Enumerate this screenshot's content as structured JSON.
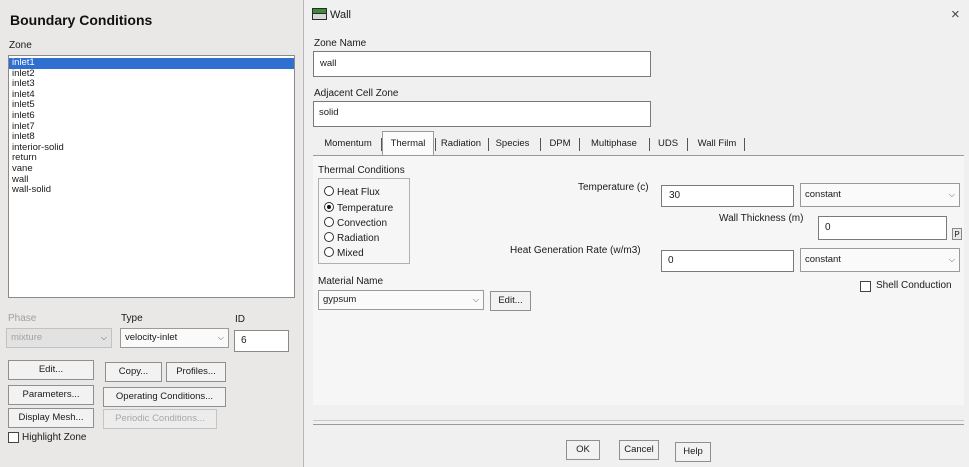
{
  "left_panel": {
    "title": "Boundary Conditions",
    "zone_label": "Zone",
    "zones": [
      "inlet1",
      "inlet2",
      "inlet3",
      "inlet4",
      "inlet5",
      "inlet6",
      "inlet7",
      "inlet8",
      "interior-solid",
      "return",
      "vane",
      "wall",
      "wall-solid"
    ],
    "selected_zone": "inlet1",
    "phase_label": "Phase",
    "phase_value": "mixture",
    "type_label": "Type",
    "type_value": "velocity-inlet",
    "id_label": "ID",
    "id_value": "6",
    "buttons": {
      "edit": "Edit...",
      "copy": "Copy...",
      "profiles": "Profiles...",
      "parameters": "Parameters...",
      "operating_conditions": "Operating Conditions...",
      "display_mesh": "Display Mesh...",
      "periodic_conditions": "Periodic Conditions..."
    },
    "highlight_zone_label": "Highlight Zone",
    "highlight_zone_checked": false
  },
  "dialog": {
    "title": "Wall",
    "close_glyph": "×",
    "zone_name_label": "Zone Name",
    "zone_name_value": "wall",
    "adjacent_cell_zone_label": "Adjacent Cell Zone",
    "adjacent_cell_zone_value": "solid",
    "tabs": [
      "Momentum",
      "Thermal",
      "Radiation",
      "Species",
      "DPM",
      "Multiphase",
      "UDS",
      "Wall Film"
    ],
    "active_tab": "Thermal",
    "thermal": {
      "conditions_label": "Thermal Conditions",
      "options": [
        "Heat Flux",
        "Temperature",
        "Convection",
        "Radiation",
        "Mixed"
      ],
      "selected_option": "Temperature",
      "temperature_label": "Temperature (c)",
      "temperature_value": "30",
      "temperature_method": "constant",
      "wall_thickness_label": "Wall Thickness (m)",
      "wall_thickness_value": "0",
      "wall_thickness_param": "P",
      "heat_generation_label": "Heat Generation Rate (w/m3)",
      "heat_generation_value": "0",
      "heat_generation_method": "constant",
      "material_name_label": "Material Name",
      "material_name_value": "gypsum",
      "material_edit_label": "Edit...",
      "shell_conduction_label": "Shell Conduction",
      "shell_conduction_checked": false
    },
    "footer_buttons": {
      "ok": "OK",
      "cancel": "Cancel",
      "help": "Help"
    }
  },
  "colors": {
    "selection": "#2f6fd0",
    "window_bg": "#f0f0f0",
    "icon_green": "#2f8a3a"
  }
}
